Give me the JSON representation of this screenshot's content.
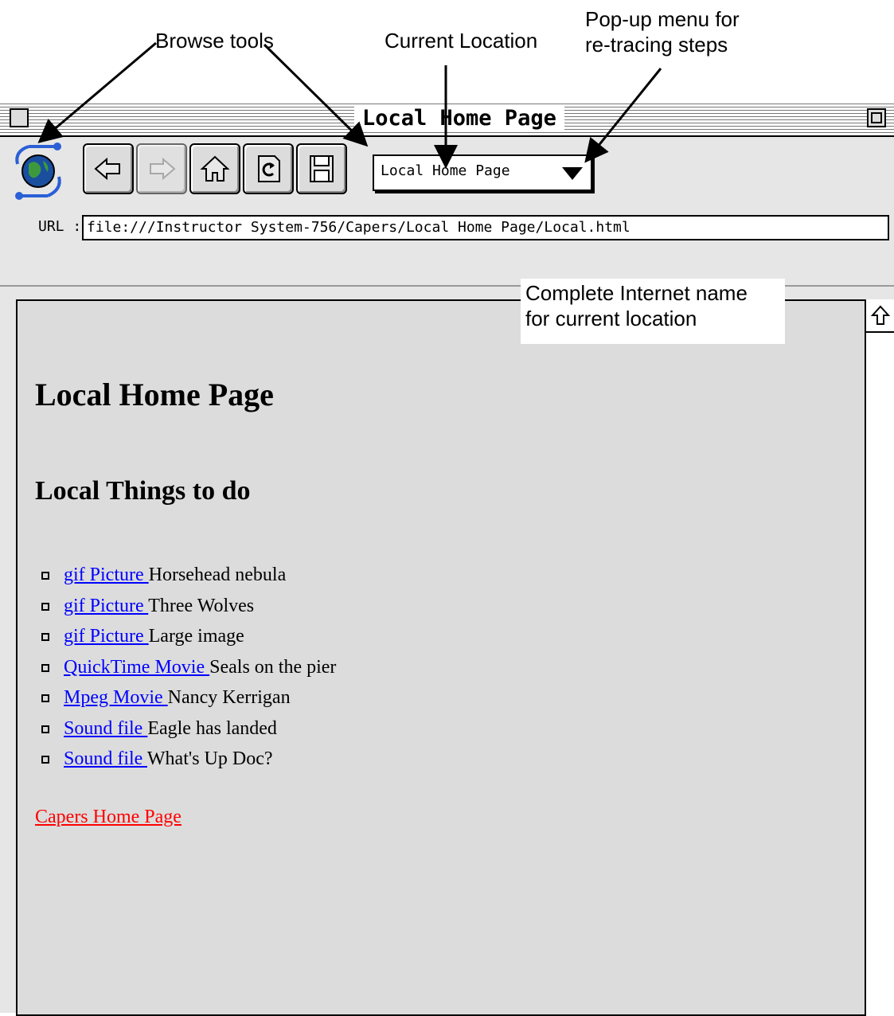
{
  "annotations": {
    "browse_tools": "Browse tools",
    "current_location": "Current Location",
    "popup_menu_line1": "Pop-up menu for",
    "popup_menu_line2": "re-tracing steps",
    "internet_name_line1": "Complete Internet name",
    "internet_name_line2": "for current location"
  },
  "window": {
    "title": "Local Home Page"
  },
  "toolbar": {
    "icons": [
      "globe-logo-icon",
      "back-arrow-icon",
      "forward-arrow-icon",
      "home-icon",
      "reload-document-icon",
      "save-disk-icon"
    ],
    "location_value": "Local Home Page"
  },
  "url": {
    "label": "URL :",
    "value": "file:///Instructor System-756/Capers/Local Home Page/Local.html"
  },
  "page": {
    "heading": "Local Home Page",
    "subheading": "Local Things to do",
    "items": [
      {
        "link": "gif Picture ",
        "text": "Horsehead nebula"
      },
      {
        "link": "gif Picture ",
        "text": "Three Wolves"
      },
      {
        "link": "gif Picture ",
        "text": "Large image"
      },
      {
        "link": "QuickTime Movie ",
        "text": "Seals on the pier"
      },
      {
        "link": "Mpeg Movie ",
        "text": "Nancy Kerrigan"
      },
      {
        "link": "Sound file ",
        "text": "Eagle has landed"
      },
      {
        "link": "Sound file ",
        "text": "What's Up Doc?"
      }
    ],
    "footer_link": "Capers Home Page "
  },
  "colors": {
    "link": "#0000ff",
    "visited_link": "#ff0000",
    "content_bg": "#dcdcdc"
  }
}
